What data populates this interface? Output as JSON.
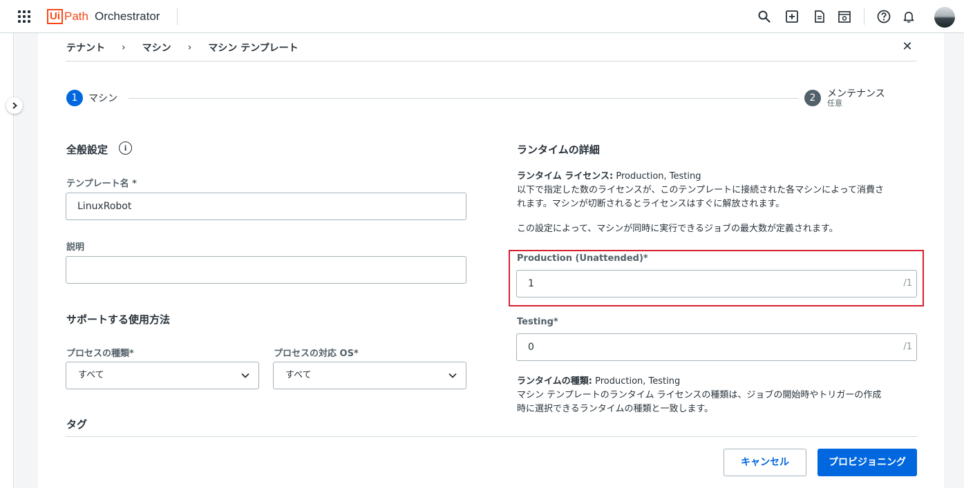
{
  "app": {
    "brand_ui": "Ui",
    "brand_path": "Path",
    "product": "Orchestrator"
  },
  "breadcrumb": [
    "テナント",
    "マシン",
    "マシン テンプレート"
  ],
  "stepper": {
    "step1": {
      "number": "1",
      "label": "マシン"
    },
    "step2": {
      "number": "2",
      "label": "メンテナンス",
      "sub": "任意"
    }
  },
  "general": {
    "title": "全般設定",
    "template_name_label": "テンプレート名 *",
    "template_name_value": "LinuxRobot",
    "description_label": "説明",
    "description_value": ""
  },
  "usage": {
    "title": "サポートする使用方法",
    "process_type_label": "プロセスの種類*",
    "process_type_value": "すべて",
    "process_os_label": "プロセスの対応 OS*",
    "process_os_value": "すべて"
  },
  "tags": {
    "title": "タグ"
  },
  "runtime": {
    "title": "ランタイムの詳細",
    "license_label": "ランタイム ライセンス:",
    "license_value": "Production, Testing",
    "license_desc1": "以下で指定した数のライセンスが、このテンプレートに接続された各マシンによって消費さ",
    "license_desc2": "れます。マシンが切断されるとライセンスはすぐに解放されます。",
    "limit_desc": "この設定によって、マシンが同時に実行できるジョブの最大数が定義されます。",
    "production_label": "Production (Unattended)*",
    "production_value": "1",
    "production_suffix": "/1",
    "testing_label": "Testing*",
    "testing_value": "0",
    "testing_suffix": "/1",
    "type_label": "ランタイムの種類:",
    "type_value": "Production, Testing",
    "type_desc1": "マシン テンプレートのランタイム ライセンスの種類は、ジョブの開始時やトリガーの作成",
    "type_desc2": "時に選択できるランタイムの種類と一致します。"
  },
  "footer": {
    "cancel": "キャンセル",
    "provision": "プロビジョニング"
  },
  "colors": {
    "accent": "#0067df",
    "highlight": "#d81e2c",
    "brand": "#fa4616"
  }
}
